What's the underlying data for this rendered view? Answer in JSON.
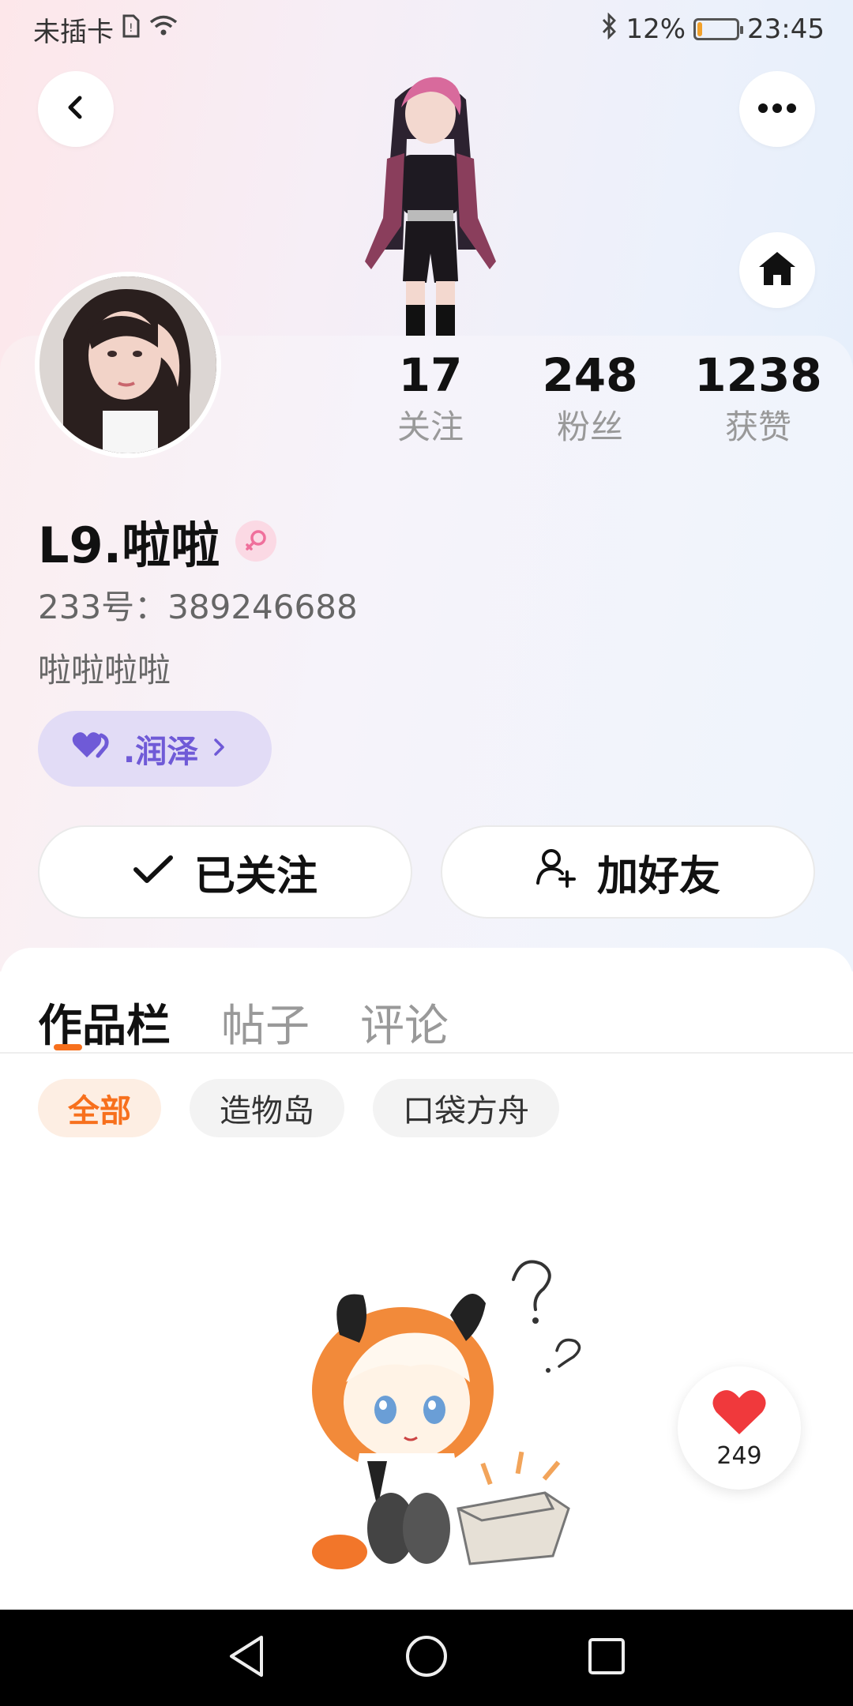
{
  "status_bar": {
    "carrier": "未插卡",
    "battery": "12%",
    "battery_level": 0.12,
    "time": "23:45"
  },
  "profile": {
    "stats": [
      {
        "value": "17",
        "label": "关注"
      },
      {
        "value": "248",
        "label": "粉丝"
      },
      {
        "value": "1238",
        "label": "获赞"
      }
    ],
    "nickname": "L9.啦啦",
    "uid": "233号：389246688",
    "bio": "啦啦啦啦",
    "tag": ".润泽"
  },
  "actions": {
    "follow_label": "已关注",
    "add_friend_label": "加好友"
  },
  "tabs": [
    {
      "label": "作品栏",
      "active": true
    },
    {
      "label": "帖子",
      "active": false
    },
    {
      "label": "评论",
      "active": false
    }
  ],
  "filters": [
    {
      "label": "全部",
      "active": true
    },
    {
      "label": "造物岛",
      "active": false
    },
    {
      "label": "口袋方舟",
      "active": false
    }
  ],
  "likes": {
    "count": "249"
  },
  "colors": {
    "accent": "#f7701d",
    "tag_purple": "#6f5ad7",
    "like_red": "#f0393c"
  },
  "icons": {
    "back": "chevron-left-icon",
    "more": "more-dots-icon",
    "home": "home-icon",
    "follow": "check-icon",
    "add_friend": "add-user-icon",
    "heart": "heart-icon"
  }
}
